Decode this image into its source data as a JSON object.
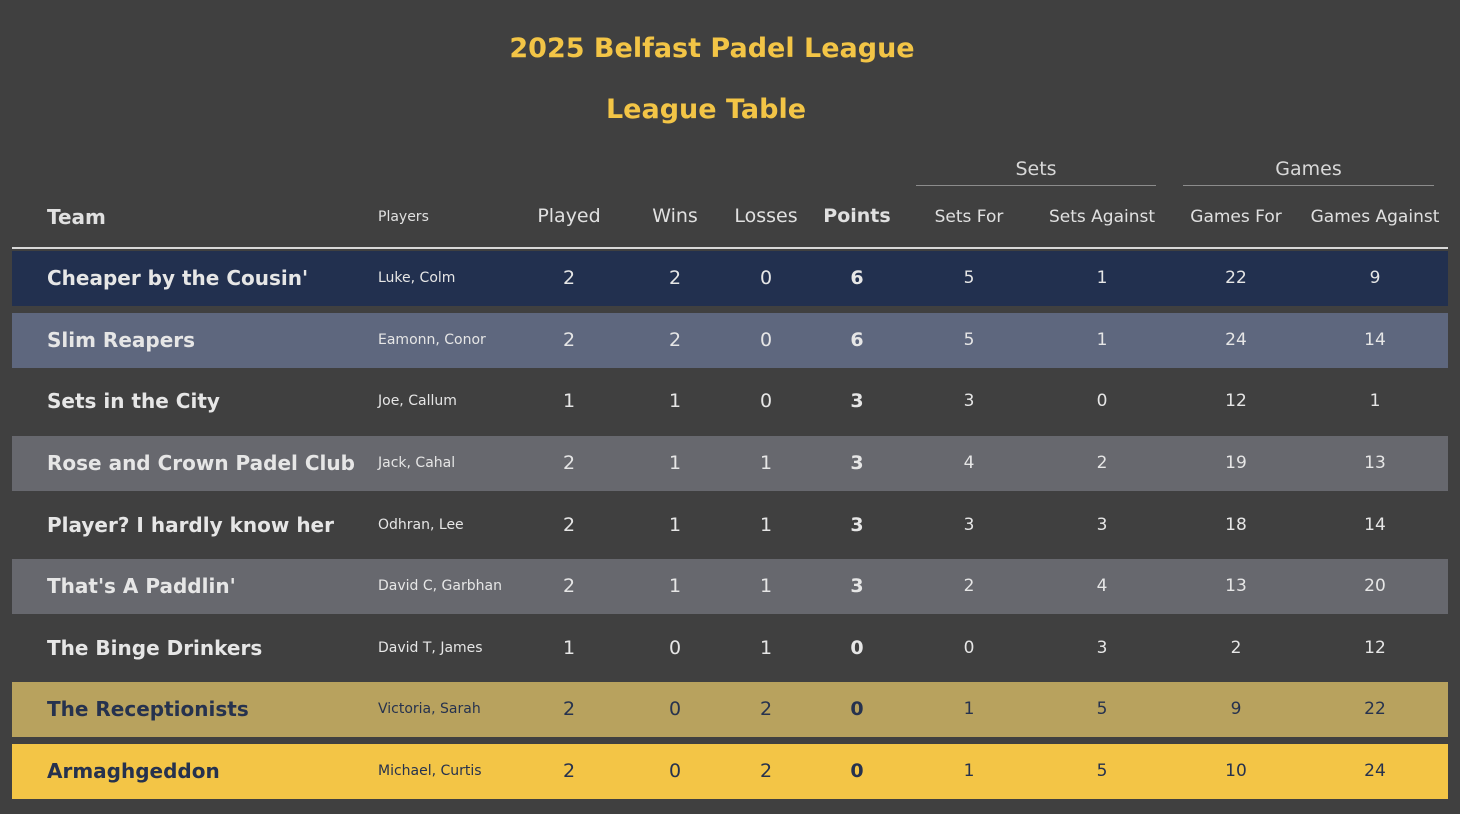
{
  "title": "2025 Belfast Padel League",
  "subtitle": "League Table",
  "groups": {
    "sets": "Sets",
    "games": "Games"
  },
  "headers": {
    "team": "Team",
    "players": "Players",
    "played": "Played",
    "wins": "Wins",
    "losses": "Losses",
    "points": "Points",
    "sets_for": "Sets For",
    "sets_against": "Sets Against",
    "games_for": "Games For",
    "games_against": "Games Against"
  },
  "colors": {
    "background": "#404040",
    "accent": "#f3c546",
    "row_first": "#22304f",
    "row_second": "#5e677e",
    "row_mid": "#67686e",
    "row_second_last": "#b8a25e",
    "row_last": "#f3c546"
  },
  "rows": [
    {
      "team": "Cheaper by the Cousin'",
      "players": "Luke, Colm",
      "played": "2",
      "wins": "2",
      "losses": "0",
      "points": "6",
      "sets_for": "5",
      "sets_against": "1",
      "games_for": "22",
      "games_against": "9"
    },
    {
      "team": "Slim Reapers",
      "players": "Eamonn, Conor",
      "played": "2",
      "wins": "2",
      "losses": "0",
      "points": "6",
      "sets_for": "5",
      "sets_against": "1",
      "games_for": "24",
      "games_against": "14"
    },
    {
      "team": "Sets in the City",
      "players": "Joe, Callum",
      "played": "1",
      "wins": "1",
      "losses": "0",
      "points": "3",
      "sets_for": "3",
      "sets_against": "0",
      "games_for": "12",
      "games_against": "1"
    },
    {
      "team": "Rose and Crown Padel Club",
      "players": "Jack, Cahal",
      "played": "2",
      "wins": "1",
      "losses": "1",
      "points": "3",
      "sets_for": "4",
      "sets_against": "2",
      "games_for": "19",
      "games_against": "13"
    },
    {
      "team": "Player? I hardly know her",
      "players": "Odhran, Lee",
      "played": "2",
      "wins": "1",
      "losses": "1",
      "points": "3",
      "sets_for": "3",
      "sets_against": "3",
      "games_for": "18",
      "games_against": "14"
    },
    {
      "team": "That's A Paddlin'",
      "players": "David C, Garbhan",
      "played": "2",
      "wins": "1",
      "losses": "1",
      "points": "3",
      "sets_for": "2",
      "sets_against": "4",
      "games_for": "13",
      "games_against": "20"
    },
    {
      "team": "The Binge Drinkers",
      "players": "David T, James",
      "played": "1",
      "wins": "0",
      "losses": "1",
      "points": "0",
      "sets_for": "0",
      "sets_against": "3",
      "games_for": "2",
      "games_against": "12"
    },
    {
      "team": "The Receptionists",
      "players": "Victoria, Sarah",
      "played": "2",
      "wins": "0",
      "losses": "2",
      "points": "0",
      "sets_for": "1",
      "sets_against": "5",
      "games_for": "9",
      "games_against": "22"
    },
    {
      "team": "Armaghgeddon",
      "players": "Michael, Curtis",
      "played": "2",
      "wins": "0",
      "losses": "2",
      "points": "0",
      "sets_for": "1",
      "sets_against": "5",
      "games_for": "10",
      "games_against": "24"
    }
  ]
}
